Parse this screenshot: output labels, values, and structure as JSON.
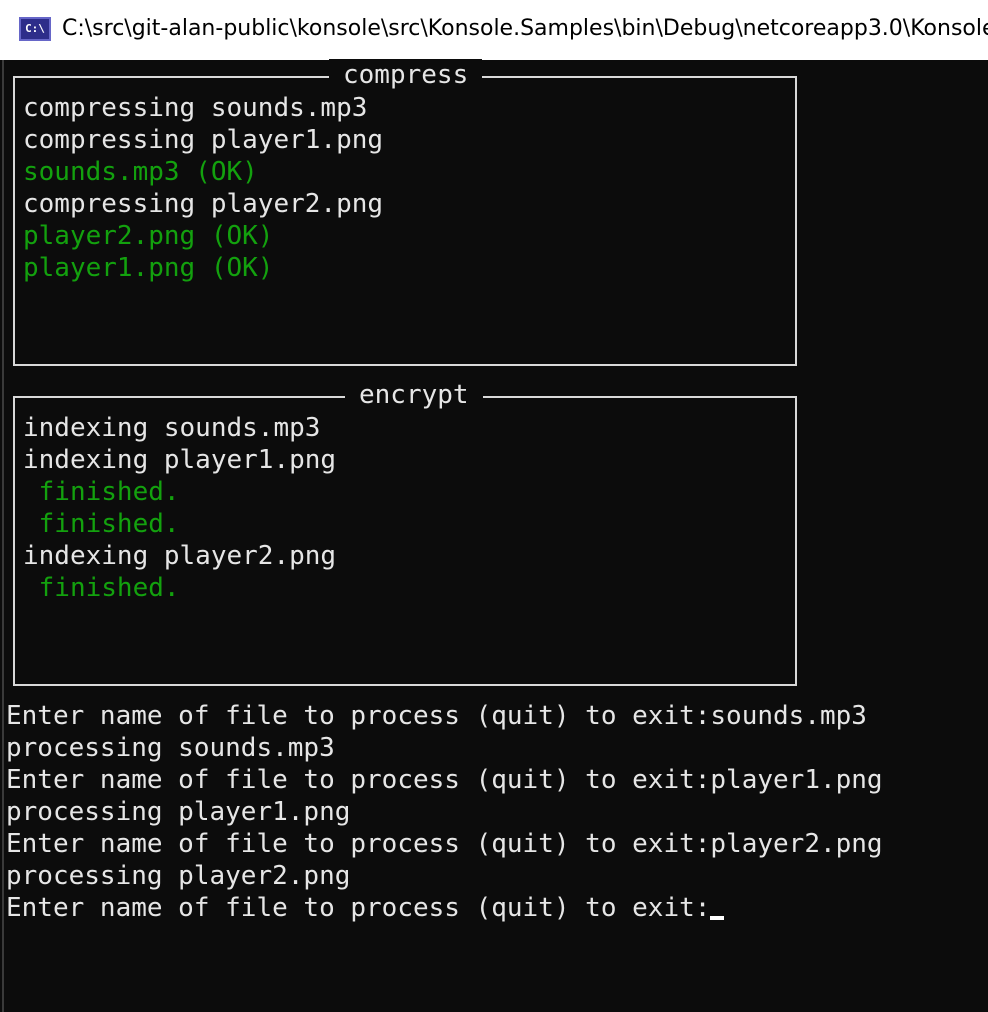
{
  "window": {
    "title": "C:\\src\\git-alan-public\\konsole\\src\\Konsole.Samples\\bin\\Debug\\netcoreapp3.0\\Konsole",
    "icon": "console-app-icon",
    "icon_text": "C:\\"
  },
  "colors": {
    "background": "#0c0c0c",
    "text": "#e6e6e6",
    "success": "#13a10e",
    "border": "#d9d9d9"
  },
  "compress_panel": {
    "title": "compress",
    "lines": [
      {
        "text": "compressing sounds.mp3",
        "status": "normal"
      },
      {
        "text": "compressing player1.png",
        "status": "normal"
      },
      {
        "text": "sounds.mp3 (OK)",
        "status": "ok"
      },
      {
        "text": "compressing player2.png",
        "status": "normal"
      },
      {
        "text": "player2.png (OK)",
        "status": "ok"
      },
      {
        "text": "player1.png (OK)",
        "status": "ok"
      }
    ]
  },
  "encrypt_panel": {
    "title": "encrypt",
    "lines": [
      {
        "text": "indexing sounds.mp3",
        "status": "normal"
      },
      {
        "text": "indexing player1.png",
        "status": "normal"
      },
      {
        "text": " finished.",
        "status": "ok"
      },
      {
        "text": " finished.",
        "status": "ok"
      },
      {
        "text": "indexing player2.png",
        "status": "normal"
      },
      {
        "text": " finished.",
        "status": "ok"
      }
    ]
  },
  "output": {
    "lines": [
      "Enter name of file to process (quit) to exit:sounds.mp3",
      "processing sounds.mp3",
      "Enter name of file to process (quit) to exit:player1.png",
      "processing player1.png",
      "Enter name of file to process (quit) to exit:player2.png",
      "processing player2.png"
    ],
    "prompt": "Enter name of file to process (quit) to exit:",
    "input_value": ""
  }
}
